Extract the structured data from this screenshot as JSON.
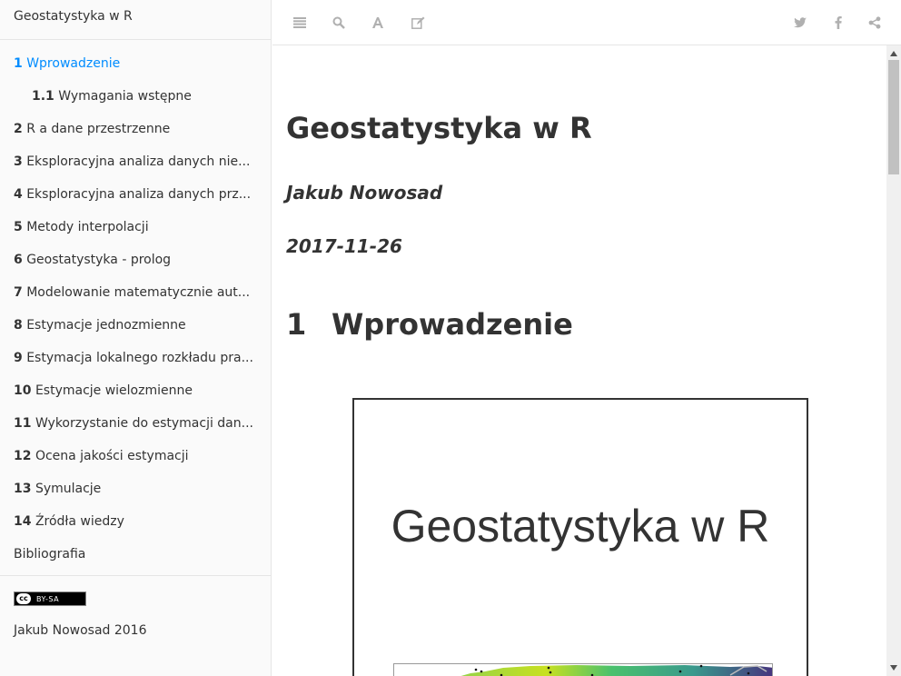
{
  "sidebar": {
    "book_title": "Geostatystyka w R",
    "toc": [
      {
        "num": "1",
        "label": "Wprowadzenie",
        "active": true,
        "sub": false
      },
      {
        "num": "1.1",
        "label": "Wymagania wstępne",
        "active": false,
        "sub": true
      },
      {
        "num": "2",
        "label": "R a dane przestrzenne",
        "active": false,
        "sub": false
      },
      {
        "num": "3",
        "label": "Eksploracyjna analiza danych nie...",
        "active": false,
        "sub": false
      },
      {
        "num": "4",
        "label": "Eksploracyjna analiza danych prz...",
        "active": false,
        "sub": false
      },
      {
        "num": "5",
        "label": "Metody interpolacji",
        "active": false,
        "sub": false
      },
      {
        "num": "6",
        "label": "Geostatystyka - prolog",
        "active": false,
        "sub": false
      },
      {
        "num": "7",
        "label": "Modelowanie matematycznie aut...",
        "active": false,
        "sub": false
      },
      {
        "num": "8",
        "label": "Estymacje jednozmienne",
        "active": false,
        "sub": false
      },
      {
        "num": "9",
        "label": "Estymacja lokalnego rozkładu pra...",
        "active": false,
        "sub": false
      },
      {
        "num": "10",
        "label": "Estymacje wielozmienne",
        "active": false,
        "sub": false
      },
      {
        "num": "11",
        "label": "Wykorzystanie do estymacji dan...",
        "active": false,
        "sub": false
      },
      {
        "num": "12",
        "label": "Ocena jakości estymacji",
        "active": false,
        "sub": false
      },
      {
        "num": "13",
        "label": "Symulacje",
        "active": false,
        "sub": false
      },
      {
        "num": "14",
        "label": "Źródła wiedzy",
        "active": false,
        "sub": false
      },
      {
        "num": "",
        "label": "Bibliografia",
        "active": false,
        "sub": false
      }
    ],
    "license_badge": "BY-SA",
    "license_cc": "cc",
    "footer_author": "Jakub Nowosad 2016"
  },
  "toolbar": {
    "left_icons": [
      "menu-icon",
      "search-icon",
      "font-icon",
      "edit-icon"
    ],
    "right_icons": [
      "twitter-icon",
      "facebook-icon",
      "share-icon"
    ],
    "icon_color": "#b0b0b0"
  },
  "content": {
    "title": "Geostatystyka w R",
    "author": "Jakub Nowosad",
    "date": "2017-11-26",
    "section_number": "1",
    "section_title": "Wprowadzenie",
    "cover_title": "Geostatystyka w R"
  },
  "colors": {
    "accent": "#008cff",
    "text": "#333333",
    "sidebar_bg": "#fafafa"
  }
}
